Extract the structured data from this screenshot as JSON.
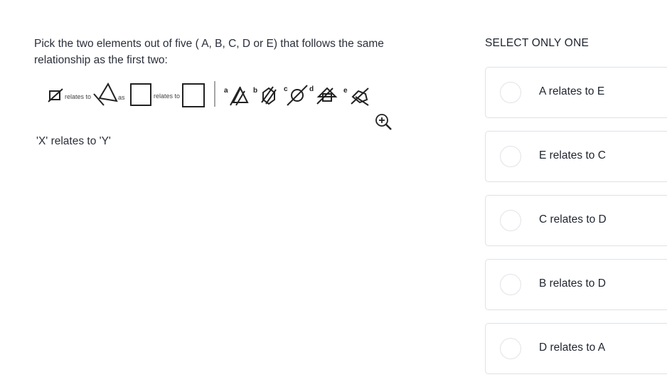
{
  "question": {
    "text": "Pick the two elements out of five ( A, B, C, D or E) that follows the same relationship as the first two:"
  },
  "figure": {
    "relates_to_1": "relates to",
    "as": "as",
    "relates_to_2": "relates to",
    "labels": [
      "a",
      "b",
      "c",
      "d",
      "e"
    ]
  },
  "zoom": {
    "icon": "zoom-in-icon"
  },
  "answer_hint": "'X' relates to 'Y'",
  "select": {
    "title": "SELECT ONLY ONE"
  },
  "options": [
    {
      "label": "A relates to E"
    },
    {
      "label": "E relates to C"
    },
    {
      "label": "C relates to D"
    },
    {
      "label": "B relates to D"
    },
    {
      "label": "D relates to A"
    }
  ]
}
